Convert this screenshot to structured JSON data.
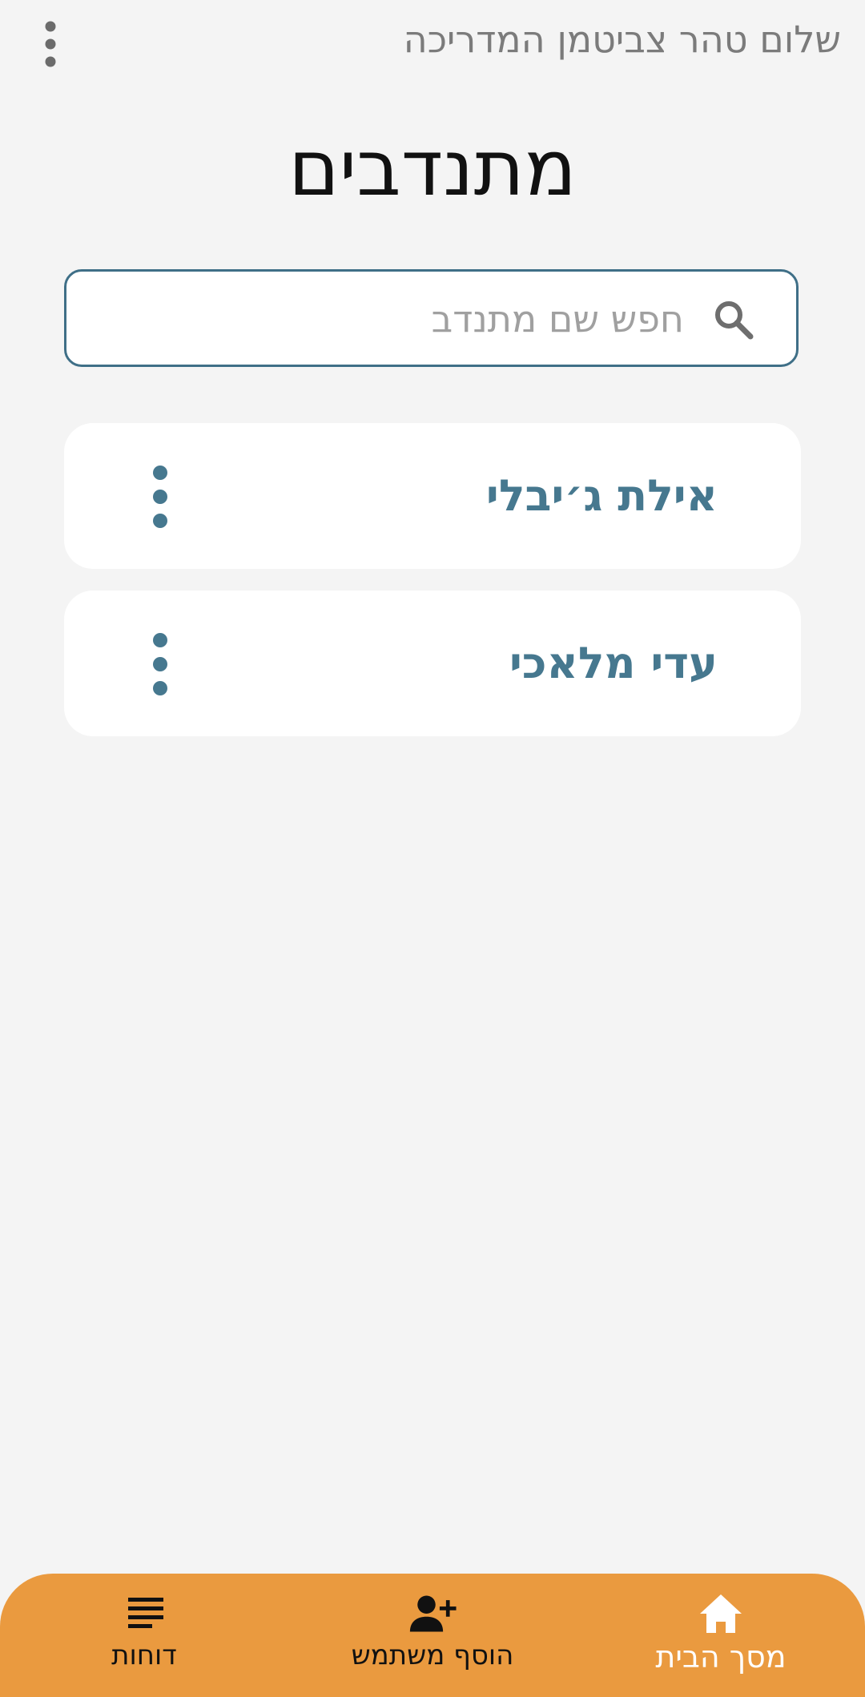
{
  "header": {
    "greeting": "שלום טהר צביטמן המדריכה",
    "overflow_icon": "more-vertical-icon"
  },
  "page": {
    "title": "מתנדבים"
  },
  "search": {
    "placeholder": "חפש שם מתנדב",
    "value": "",
    "icon": "search-icon"
  },
  "volunteers": [
    {
      "name": "אילת ג׳יבלי",
      "menu_icon": "more-vertical-icon"
    },
    {
      "name": "עדי מלאכי",
      "menu_icon": "more-vertical-icon"
    }
  ],
  "bottom_nav": {
    "items": [
      {
        "label": "מסך הבית",
        "icon": "home-icon",
        "active": true
      },
      {
        "label": "הוסף משתמש",
        "icon": "person-add-icon",
        "active": false
      },
      {
        "label": "דוחות",
        "icon": "reports-icon",
        "active": false
      }
    ]
  },
  "colors": {
    "background": "#f4f4f4",
    "accent": "#46788f",
    "search_border": "#3f6f87",
    "nav_background": "#ea9a3f",
    "greeting_text": "#7b7b7b"
  }
}
